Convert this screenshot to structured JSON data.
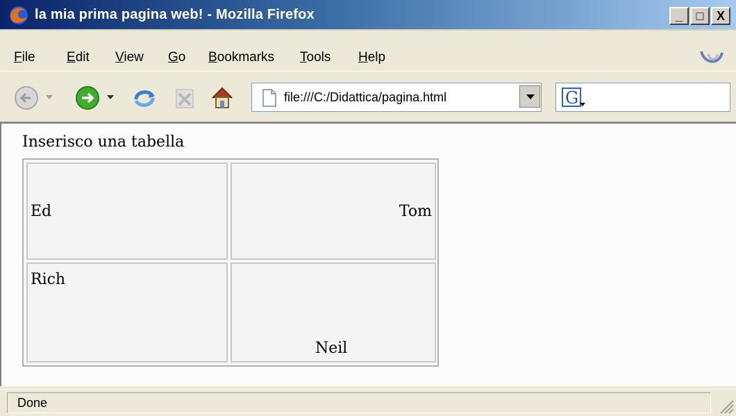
{
  "window": {
    "title": "la mia prima pagina web! - Mozilla Firefox",
    "buttons": {
      "minimize": "_",
      "maximize": "□",
      "close": "X"
    }
  },
  "menu": {
    "items": [
      {
        "label": "File",
        "accel": "F"
      },
      {
        "label": "Edit",
        "accel": "E"
      },
      {
        "label": "View",
        "accel": "V"
      },
      {
        "label": "Go",
        "accel": "G"
      },
      {
        "label": "Bookmarks",
        "accel": "B"
      },
      {
        "label": "Tools",
        "accel": "T"
      },
      {
        "label": "Help",
        "accel": "H"
      }
    ]
  },
  "toolbar": {
    "icons": [
      "back-icon",
      "forward-icon",
      "reload-icon",
      "stop-icon",
      "home-icon"
    ],
    "url": "file:///C:/Didattica/pagina.html",
    "search_engine_icon": "google-icon"
  },
  "page": {
    "intro": "Inserisco una tabella",
    "table": {
      "rows": [
        [
          "Ed",
          "Tom"
        ],
        [
          "Rich",
          "Neil"
        ]
      ]
    }
  },
  "status": {
    "text": "Done"
  }
}
